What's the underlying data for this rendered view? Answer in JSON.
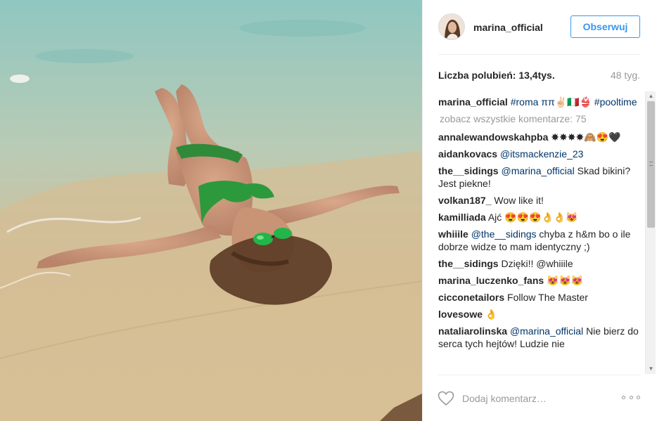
{
  "post": {
    "username": "marina_official",
    "follow_label": "Obserwuj",
    "likes_text": "Liczba polubień: 13,4tys.",
    "age_text": "48 tyg."
  },
  "caption": {
    "user": "marina_official",
    "text": "#roma ππ✌🏻🇮🇹👙 #pooltime"
  },
  "view_all_label": "zobacz wszystkie komentarze: 75",
  "comments": [
    {
      "user": "annalewandowskahpba",
      "mention": "",
      "text": "✸✸✸✸🙈😍🖤"
    },
    {
      "user": "aidankovacs",
      "mention": "@itsmackenzie_23",
      "text": ""
    },
    {
      "user": "the__sidings",
      "mention": "@marina_official",
      "text": "Skad bikini? Jest piekne!"
    },
    {
      "user": "volkan187_",
      "mention": "",
      "text": "Wow like it!"
    },
    {
      "user": "kamilliada",
      "mention": "",
      "text": "Ajć 😍😍😍👌👌😻"
    },
    {
      "user": "whiiile",
      "mention": "@the__sidings",
      "text": "chyba z h&m bo o ile dobrze widze to mam identyczny ;)"
    },
    {
      "user": "the__sidings",
      "mention": "",
      "text": "Dzięki!! @whiiile"
    },
    {
      "user": "marina_luczenko_fans",
      "mention": "",
      "text": "😻😻😻"
    },
    {
      "user": "cicconetailors",
      "mention": "",
      "text": "Follow The Master"
    },
    {
      "user": "lovesowe",
      "mention": "",
      "text": "👌"
    },
    {
      "user": "nataliarolinska",
      "mention": "@marina_official",
      "text": "Nie bierz do serca tych hejtów! Ludzie nie"
    }
  ],
  "footer": {
    "comment_placeholder": "Dodaj komentarz…",
    "like_icon": "heart-outline-icon",
    "more_icon": "more-dots-icon"
  },
  "colors": {
    "link": "#003569",
    "follow_blue": "#3897f0",
    "muted": "#999999"
  }
}
